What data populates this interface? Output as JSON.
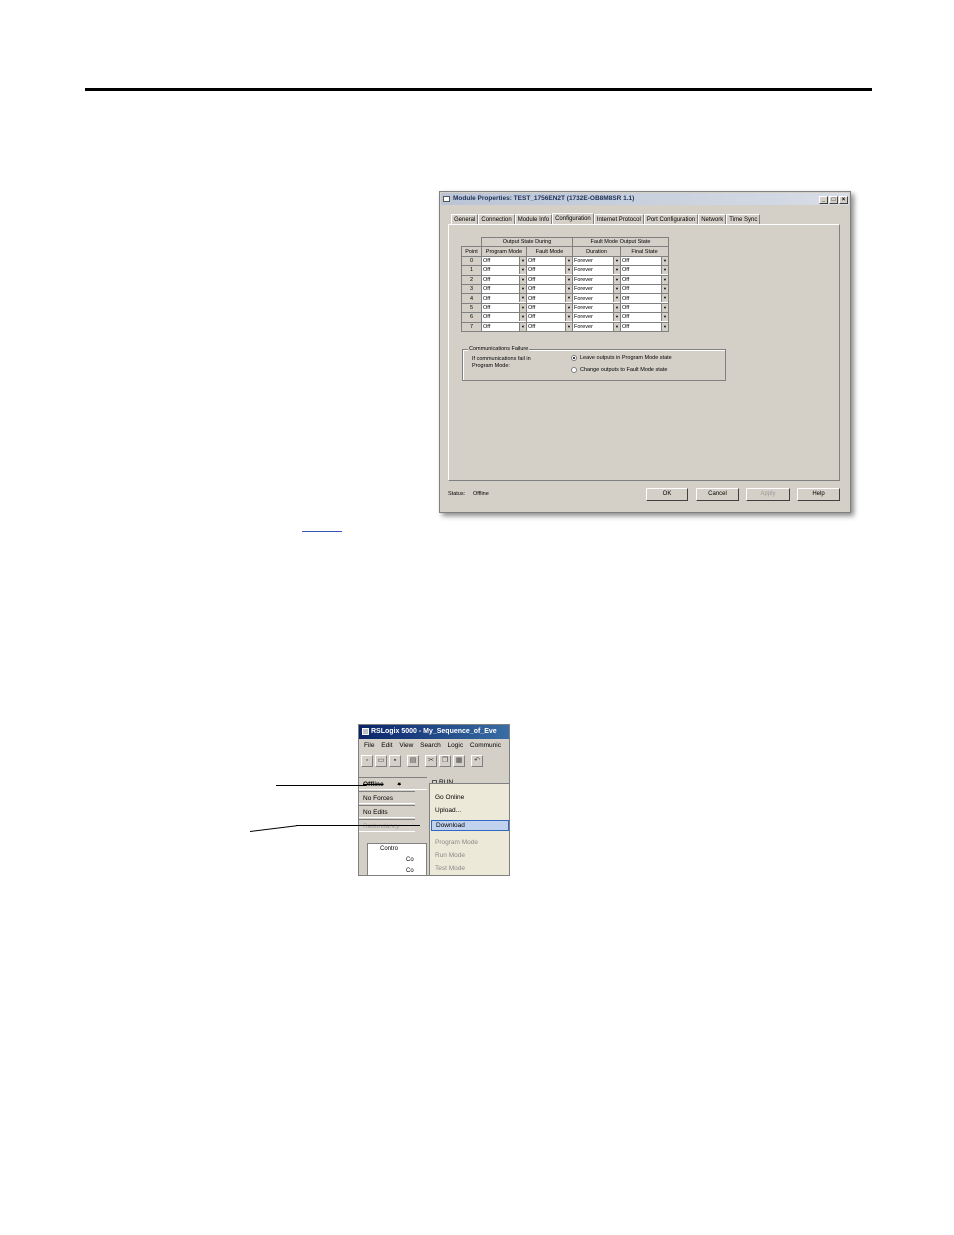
{
  "dialog": {
    "title": "Module Properties: TEST_1756EN2T (1732E-OB8M8SR 1.1)",
    "title_buttons": [
      "_",
      "□",
      "×"
    ],
    "tabs": [
      "General",
      "Connection",
      "Module Info",
      "Configuration",
      "Internet Protocol",
      "Port Configuration",
      "Network",
      "Time Sync"
    ],
    "active_tab": "Configuration",
    "table": {
      "group_headers": [
        "Output State During",
        "Fault Mode Output State"
      ],
      "columns": [
        "Point",
        "Program Mode",
        "Fault Mode",
        "Duration",
        "Final State"
      ],
      "rows": [
        [
          "0",
          "Off",
          "Off",
          "Forever",
          "Off"
        ],
        [
          "1",
          "Off",
          "Off",
          "Forever",
          "Off"
        ],
        [
          "2",
          "Off",
          "Off",
          "Forever",
          "Off"
        ],
        [
          "3",
          "Off",
          "Off",
          "Forever",
          "Off"
        ],
        [
          "4",
          "Off",
          "Off",
          "Forever",
          "Off"
        ],
        [
          "5",
          "Off",
          "Off",
          "Forever",
          "Off"
        ],
        [
          "6",
          "Off",
          "Off",
          "Forever",
          "Off"
        ],
        [
          "7",
          "Off",
          "Off",
          "Forever",
          "Off"
        ]
      ]
    },
    "comm_failure": {
      "group_label": "Communications Failure",
      "prompt_line1": "If communications fail in",
      "prompt_line2": "Program Mode:",
      "options": [
        "Leave outputs in Program Mode state",
        "Change outputs to Fault Mode state"
      ],
      "selected_index": 0
    },
    "status_label": "Status:",
    "status_value": "Offline",
    "buttons": {
      "ok": "OK",
      "cancel": "Cancel",
      "apply": "Apply",
      "help": "Help"
    }
  },
  "rslogix": {
    "title": "RSLogix 5000 - My_Sequence_of_Eve",
    "menus": [
      "File",
      "Edit",
      "View",
      "Search",
      "Logic",
      "Communic"
    ],
    "status_rows": [
      "Offline",
      "No Forces",
      "No Edits",
      "Redundancy"
    ],
    "run_label": "RUN",
    "menu_items": {
      "go_online": "Go Online",
      "upload": "Upload...",
      "download": "Download",
      "program_mode": "Program Mode",
      "run_mode": "Run Mode",
      "test_mode": "Test Mode"
    },
    "tree_items": [
      "Contro",
      "Co",
      "Co"
    ]
  }
}
